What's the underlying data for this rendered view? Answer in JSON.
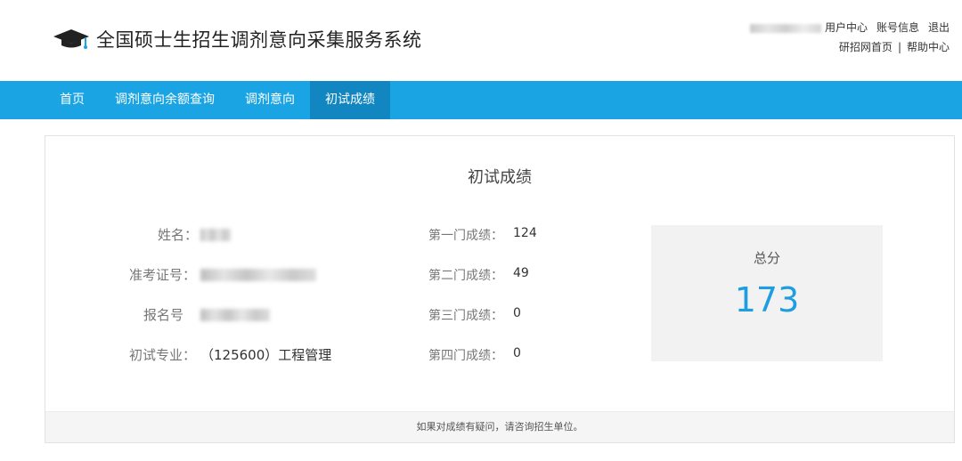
{
  "header": {
    "title": "全国硕士生招生调剂意向采集服务系统",
    "logo_icon": "graduation-cap-icon",
    "links_row1": [
      "用户中心",
      "账号信息",
      "退出"
    ],
    "links_row2": [
      "研招网首页",
      "帮助中心"
    ],
    "separator": "|"
  },
  "nav": {
    "items": [
      "首页",
      "调剂意向余额查询",
      "调剂意向",
      "初试成绩"
    ],
    "active": "初试成绩"
  },
  "card": {
    "title": "初试成绩",
    "name_label": "姓名：",
    "exam_id_label": "准考证号：",
    "reg_id_label": "报名号",
    "major_label": "初试专业：",
    "major_value": "（125600）工程管理",
    "scores": [
      {
        "label": "第一门成绩：",
        "value": "124"
      },
      {
        "label": "第二门成绩：",
        "value": "49"
      },
      {
        "label": "第三门成绩：",
        "value": "0"
      },
      {
        "label": "第四门成绩：",
        "value": "0"
      }
    ],
    "total_label": "总分",
    "total_value": "173",
    "footer_note": "如果对成绩有疑问，请咨询招生单位。"
  },
  "colors": {
    "nav_bg": "#1aa4e4",
    "nav_active_bg": "#1186c0",
    "total_value": "#1e9ee0"
  }
}
